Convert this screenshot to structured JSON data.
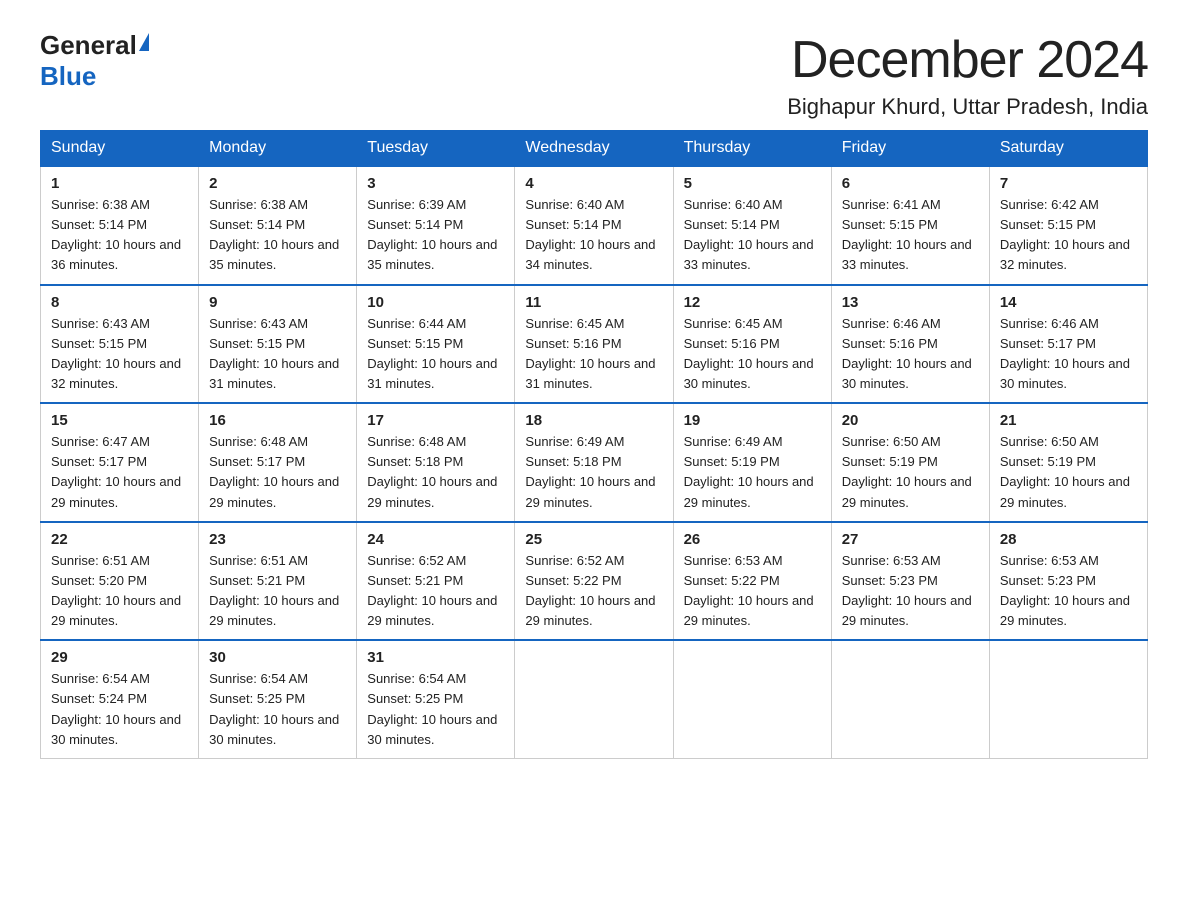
{
  "logo": {
    "general": "General",
    "blue": "Blue"
  },
  "title": "December 2024",
  "location": "Bighapur Khurd, Uttar Pradesh, India",
  "weekdays": [
    "Sunday",
    "Monday",
    "Tuesday",
    "Wednesday",
    "Thursday",
    "Friday",
    "Saturday"
  ],
  "weeks": [
    [
      {
        "day": "1",
        "sunrise": "6:38 AM",
        "sunset": "5:14 PM",
        "daylight": "10 hours and 36 minutes."
      },
      {
        "day": "2",
        "sunrise": "6:38 AM",
        "sunset": "5:14 PM",
        "daylight": "10 hours and 35 minutes."
      },
      {
        "day": "3",
        "sunrise": "6:39 AM",
        "sunset": "5:14 PM",
        "daylight": "10 hours and 35 minutes."
      },
      {
        "day": "4",
        "sunrise": "6:40 AM",
        "sunset": "5:14 PM",
        "daylight": "10 hours and 34 minutes."
      },
      {
        "day": "5",
        "sunrise": "6:40 AM",
        "sunset": "5:14 PM",
        "daylight": "10 hours and 33 minutes."
      },
      {
        "day": "6",
        "sunrise": "6:41 AM",
        "sunset": "5:15 PM",
        "daylight": "10 hours and 33 minutes."
      },
      {
        "day": "7",
        "sunrise": "6:42 AM",
        "sunset": "5:15 PM",
        "daylight": "10 hours and 32 minutes."
      }
    ],
    [
      {
        "day": "8",
        "sunrise": "6:43 AM",
        "sunset": "5:15 PM",
        "daylight": "10 hours and 32 minutes."
      },
      {
        "day": "9",
        "sunrise": "6:43 AM",
        "sunset": "5:15 PM",
        "daylight": "10 hours and 31 minutes."
      },
      {
        "day": "10",
        "sunrise": "6:44 AM",
        "sunset": "5:15 PM",
        "daylight": "10 hours and 31 minutes."
      },
      {
        "day": "11",
        "sunrise": "6:45 AM",
        "sunset": "5:16 PM",
        "daylight": "10 hours and 31 minutes."
      },
      {
        "day": "12",
        "sunrise": "6:45 AM",
        "sunset": "5:16 PM",
        "daylight": "10 hours and 30 minutes."
      },
      {
        "day": "13",
        "sunrise": "6:46 AM",
        "sunset": "5:16 PM",
        "daylight": "10 hours and 30 minutes."
      },
      {
        "day": "14",
        "sunrise": "6:46 AM",
        "sunset": "5:17 PM",
        "daylight": "10 hours and 30 minutes."
      }
    ],
    [
      {
        "day": "15",
        "sunrise": "6:47 AM",
        "sunset": "5:17 PM",
        "daylight": "10 hours and 29 minutes."
      },
      {
        "day": "16",
        "sunrise": "6:48 AM",
        "sunset": "5:17 PM",
        "daylight": "10 hours and 29 minutes."
      },
      {
        "day": "17",
        "sunrise": "6:48 AM",
        "sunset": "5:18 PM",
        "daylight": "10 hours and 29 minutes."
      },
      {
        "day": "18",
        "sunrise": "6:49 AM",
        "sunset": "5:18 PM",
        "daylight": "10 hours and 29 minutes."
      },
      {
        "day": "19",
        "sunrise": "6:49 AM",
        "sunset": "5:19 PM",
        "daylight": "10 hours and 29 minutes."
      },
      {
        "day": "20",
        "sunrise": "6:50 AM",
        "sunset": "5:19 PM",
        "daylight": "10 hours and 29 minutes."
      },
      {
        "day": "21",
        "sunrise": "6:50 AM",
        "sunset": "5:19 PM",
        "daylight": "10 hours and 29 minutes."
      }
    ],
    [
      {
        "day": "22",
        "sunrise": "6:51 AM",
        "sunset": "5:20 PM",
        "daylight": "10 hours and 29 minutes."
      },
      {
        "day": "23",
        "sunrise": "6:51 AM",
        "sunset": "5:21 PM",
        "daylight": "10 hours and 29 minutes."
      },
      {
        "day": "24",
        "sunrise": "6:52 AM",
        "sunset": "5:21 PM",
        "daylight": "10 hours and 29 minutes."
      },
      {
        "day": "25",
        "sunrise": "6:52 AM",
        "sunset": "5:22 PM",
        "daylight": "10 hours and 29 minutes."
      },
      {
        "day": "26",
        "sunrise": "6:53 AM",
        "sunset": "5:22 PM",
        "daylight": "10 hours and 29 minutes."
      },
      {
        "day": "27",
        "sunrise": "6:53 AM",
        "sunset": "5:23 PM",
        "daylight": "10 hours and 29 minutes."
      },
      {
        "day": "28",
        "sunrise": "6:53 AM",
        "sunset": "5:23 PM",
        "daylight": "10 hours and 29 minutes."
      }
    ],
    [
      {
        "day": "29",
        "sunrise": "6:54 AM",
        "sunset": "5:24 PM",
        "daylight": "10 hours and 30 minutes."
      },
      {
        "day": "30",
        "sunrise": "6:54 AM",
        "sunset": "5:25 PM",
        "daylight": "10 hours and 30 minutes."
      },
      {
        "day": "31",
        "sunrise": "6:54 AM",
        "sunset": "5:25 PM",
        "daylight": "10 hours and 30 minutes."
      },
      null,
      null,
      null,
      null
    ]
  ]
}
